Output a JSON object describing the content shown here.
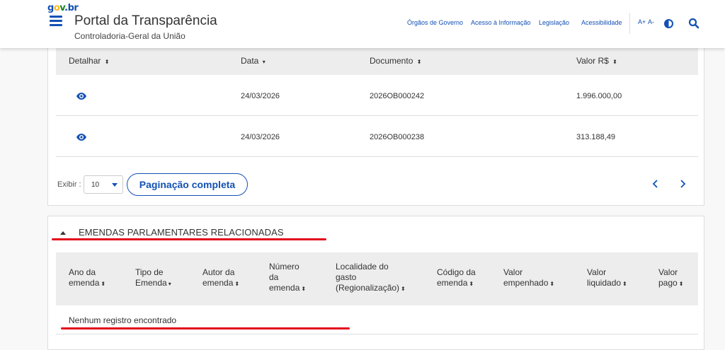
{
  "header": {
    "brand": {
      "p1": "g",
      "p2": "o",
      "p3": "v",
      "p4": ".br"
    },
    "title": "Portal da Transparência",
    "subtitle": "Controladoria-Geral da União",
    "nav": [
      "Órgãos de Governo",
      "Acesso à Informação",
      "Legislação",
      "Acessibilidade"
    ],
    "font_increase": "A+",
    "font_decrease": "A-"
  },
  "documents": {
    "columns": [
      "Detalhar",
      "Data",
      "Documento",
      "Valor R$"
    ],
    "sort_icons": [
      "⬍",
      "▾",
      "⬍",
      "⬍"
    ],
    "rows": [
      {
        "data": "24/03/2026",
        "documento": "2026OB000242",
        "valor": "1.996.000,00"
      },
      {
        "data": "24/03/2026",
        "documento": "2026OB000238",
        "valor": "313.188,49"
      }
    ],
    "show_label": "Exibir :",
    "page_size": "10",
    "full_pagination": "Paginação completa"
  },
  "amendments": {
    "title": "EMENDAS PARLAMENTARES RELACIONADAS",
    "columns": [
      {
        "lines": [
          "Ano da",
          "emenda"
        ],
        "sort": "⬍"
      },
      {
        "lines": [
          "Tipo de",
          "Emenda"
        ],
        "sort": "▾"
      },
      {
        "lines": [
          "Autor da",
          "emenda"
        ],
        "sort": "⬍"
      },
      {
        "lines": [
          "Número",
          "da",
          "emenda"
        ],
        "sort": "⬍"
      },
      {
        "lines": [
          "Localidade do",
          "gasto",
          "(Regionalização)"
        ],
        "sort": "⬍"
      },
      {
        "lines": [
          "Código da",
          "emenda"
        ],
        "sort": "⬍"
      },
      {
        "lines": [
          "Valor",
          "empenhado"
        ],
        "sort": "⬍"
      },
      {
        "lines": [
          "Valor",
          "liquidado"
        ],
        "sort": "⬍"
      },
      {
        "lines": [
          "Valor",
          "pago"
        ],
        "sort": "⬍"
      }
    ],
    "empty_message": "Nenhum registro encontrado"
  },
  "colors": {
    "primary": "#1351b4",
    "annotation": "#e2081c"
  }
}
